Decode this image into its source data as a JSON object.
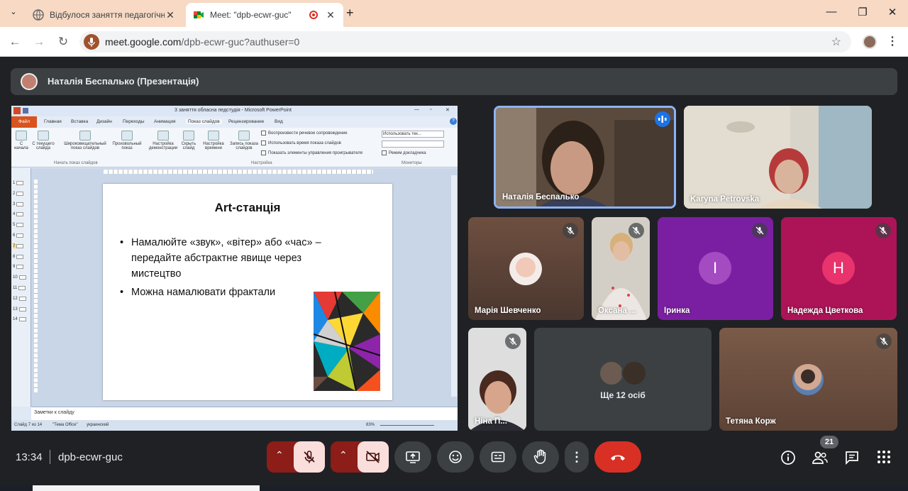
{
  "browser": {
    "tabs": [
      {
        "title": "Відбулося заняття педагогічно",
        "favicon": "globe-icon",
        "active": false
      },
      {
        "title": "Meet: \"dpb-ecwr-guc\"",
        "favicon": "meet-icon",
        "active": true,
        "recording": true
      }
    ],
    "url_domain": "meet.google.com",
    "url_path": "/dpb-ecwr-guc?authuser=0"
  },
  "presentation": {
    "banner_title": "Наталія Беспалько (Презентація)",
    "ppt_window_title": "3 заняття обласна педстудія  -  Microsoft PowerPoint",
    "ribbon_tabs": [
      "Файл",
      "Главная",
      "Вставка",
      "Дизайн",
      "Переходы",
      "Анимация",
      "Показ слайдов",
      "Рецензирование",
      "Вид"
    ],
    "ribbon_buttons": [
      "С начала",
      "С текущего слайда",
      "Широковещательный показ слайдов",
      "Произвольный показ",
      "Настройка демонстрации",
      "Скрыть слайд",
      "Настройка времени",
      "Запись показа слайдов"
    ],
    "ribbon_checkboxes": [
      "Воспроизвести речевое сопровождение",
      "Использовать время показа слайдов",
      "Показать элементы управления проигрывателя"
    ],
    "monitor_options": [
      "Использовать тек...",
      "Режим докладчика"
    ],
    "ribbon_groups": [
      "Начать показ слайдов",
      "Настройка",
      "Мониторы"
    ],
    "slide_numbers": [
      "1",
      "2",
      "3",
      "4",
      "5",
      "6",
      "7",
      "8",
      "9",
      "10",
      "11",
      "12",
      "13",
      "14"
    ],
    "current_slide": "7",
    "slide": {
      "title": "Art-станція",
      "bullets": [
        "Намалюйте «звук», «вітер» або «час» – передайте абстрактне явище через мистецтво",
        "Можна намалювати фрактали"
      ]
    },
    "notes_placeholder": "Заметки к слайду",
    "status_slide": "Слайд 7 из 14",
    "status_theme": "\"Тема Office\"",
    "status_language": "украинский",
    "zoom": "83%"
  },
  "participants": [
    {
      "name": "Наталія Беспалько",
      "speaking": true
    },
    {
      "name": "Karyna Petrovska"
    },
    {
      "name": "Марія Шевченко",
      "muted": true
    },
    {
      "name": "Оксана ...",
      "muted": true
    },
    {
      "name": "Іринка",
      "muted": true,
      "initial": "І",
      "color": "#8e24aa"
    },
    {
      "name": "Надежда Цветкова",
      "muted": true,
      "initial": "Н",
      "color": "#d81b60"
    },
    {
      "name": "Ніна П...",
      "muted": true
    },
    {
      "name": "Тетяна Корж",
      "muted": true
    }
  ],
  "others": {
    "label": "Ще 12 осіб"
  },
  "bottom_bar": {
    "time": "13:34",
    "meeting_code": "dpb-ecwr-guc",
    "participant_count": "21"
  },
  "colors": {
    "meet_bg": "#202124",
    "control_gray": "#3c4043",
    "hangup_red": "#d93025",
    "muted_red_bg": "#f9dedc",
    "tab_strip": "#f7d9c4"
  }
}
